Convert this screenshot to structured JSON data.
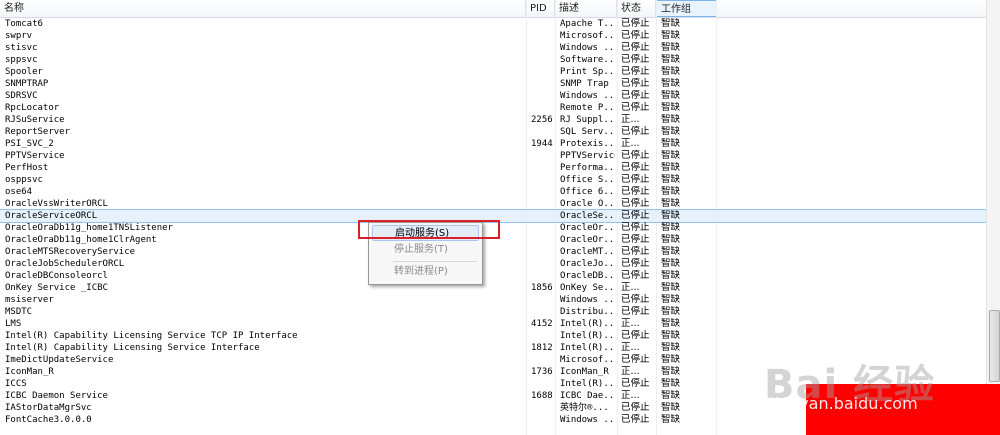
{
  "columns": {
    "name": "名称",
    "pid": "PID",
    "description": "描述",
    "status": "状态",
    "group": "工作组"
  },
  "services": [
    {
      "name": "Tomcat6",
      "pid": "",
      "desc": "Apache T...",
      "status": "已停止",
      "group": "智缺"
    },
    {
      "name": "swprv",
      "pid": "",
      "desc": "Microsof...",
      "status": "已停止",
      "group": "智缺"
    },
    {
      "name": "stisvc",
      "pid": "",
      "desc": "Windows ...",
      "status": "已停止",
      "group": "智缺"
    },
    {
      "name": "sppsvc",
      "pid": "",
      "desc": "Software...",
      "status": "已停止",
      "group": "智缺"
    },
    {
      "name": "Spooler",
      "pid": "",
      "desc": "Print Sp...",
      "status": "已停止",
      "group": "智缺"
    },
    {
      "name": "SNMPTRAP",
      "pid": "",
      "desc": "SNMP Trap",
      "status": "已停止",
      "group": "智缺"
    },
    {
      "name": "SDRSVC",
      "pid": "",
      "desc": "Windows ...",
      "status": "已停止",
      "group": "智缺"
    },
    {
      "name": "RpcLocator",
      "pid": "",
      "desc": "Remote P...",
      "status": "已停止",
      "group": "智缺"
    },
    {
      "name": "RJSuService",
      "pid": "2256",
      "desc": "RJ Suppl...",
      "status": "正...",
      "group": "智缺"
    },
    {
      "name": "ReportServer",
      "pid": "",
      "desc": "SQL Serv...",
      "status": "已停止",
      "group": "智缺"
    },
    {
      "name": "PSI_SVC_2",
      "pid": "1944",
      "desc": "Protexis...",
      "status": "正...",
      "group": "智缺"
    },
    {
      "name": "PPTVService",
      "pid": "",
      "desc": "PPTVService",
      "status": "已停止",
      "group": "智缺"
    },
    {
      "name": "PerfHost",
      "pid": "",
      "desc": "Performa...",
      "status": "已停止",
      "group": "智缺"
    },
    {
      "name": "osppsvc",
      "pid": "",
      "desc": "Office S...",
      "status": "已停止",
      "group": "智缺"
    },
    {
      "name": "ose64",
      "pid": "",
      "desc": "Office 6...",
      "status": "已停止",
      "group": "智缺"
    },
    {
      "name": "OracleVssWriterORCL",
      "pid": "",
      "desc": "Oracle O...",
      "status": "已停止",
      "group": "智缺"
    },
    {
      "name": "OracleServiceORCL",
      "pid": "",
      "desc": "OracleSe...",
      "status": "已停止",
      "group": "智缺"
    },
    {
      "name": "OracleOraDb11g_home1TNSListener",
      "pid": "",
      "desc": "OracleOr...",
      "status": "已停止",
      "group": "智缺"
    },
    {
      "name": "OracleOraDb11g_home1ClrAgent",
      "pid": "",
      "desc": "OracleOr...",
      "status": "已停止",
      "group": "智缺"
    },
    {
      "name": "OracleMTSRecoveryService",
      "pid": "",
      "desc": "OracleMT...",
      "status": "已停止",
      "group": "智缺"
    },
    {
      "name": "OracleJobSchedulerORCL",
      "pid": "",
      "desc": "OracleJo...",
      "status": "已停止",
      "group": "智缺"
    },
    {
      "name": "OracleDBConsoleorcl",
      "pid": "",
      "desc": "OracleDB...",
      "status": "已停止",
      "group": "智缺"
    },
    {
      "name": "OnKey Service _ICBC",
      "pid": "1856",
      "desc": "OnKey Se...",
      "status": "正...",
      "group": "智缺"
    },
    {
      "name": "msiserver",
      "pid": "",
      "desc": "Windows ...",
      "status": "已停止",
      "group": "智缺"
    },
    {
      "name": "MSDTC",
      "pid": "",
      "desc": "Distribu...",
      "status": "已停止",
      "group": "智缺"
    },
    {
      "name": "LMS",
      "pid": "4152",
      "desc": "Intel(R)...",
      "status": "正...",
      "group": "智缺"
    },
    {
      "name": "Intel(R) Capability Licensing Service TCP IP Interface",
      "pid": "",
      "desc": "Intel(R)...",
      "status": "已停止",
      "group": "智缺"
    },
    {
      "name": "Intel(R) Capability Licensing Service Interface",
      "pid": "1812",
      "desc": "Intel(R)...",
      "status": "正...",
      "group": "智缺"
    },
    {
      "name": "ImeDictUpdateService",
      "pid": "",
      "desc": "Microsof...",
      "status": "已停止",
      "group": "智缺"
    },
    {
      "name": "IconMan_R",
      "pid": "1736",
      "desc": "IconMan_R",
      "status": "正...",
      "group": "智缺"
    },
    {
      "name": "ICCS",
      "pid": "",
      "desc": "Intel(R)...",
      "status": "已停止",
      "group": "智缺"
    },
    {
      "name": "ICBC Daemon Service",
      "pid": "1688",
      "desc": "ICBC Dae...",
      "status": "正...",
      "group": "智缺"
    },
    {
      "name": "IAStorDataMgrSvc",
      "pid": "",
      "desc": "英特尔®...",
      "status": "已停止",
      "group": "智缺"
    },
    {
      "name": "FontCache3.0.0.0",
      "pid": "",
      "desc": "Windows ...",
      "status": "已停止",
      "group": "智缺"
    }
  ],
  "context_menu": {
    "start": "启动服务(S)",
    "stop": "停止服务(T)",
    "goto": "转到进程(P)"
  },
  "watermark": {
    "logo": "Bai 经验",
    "url": "jingyan.baidu.com"
  }
}
